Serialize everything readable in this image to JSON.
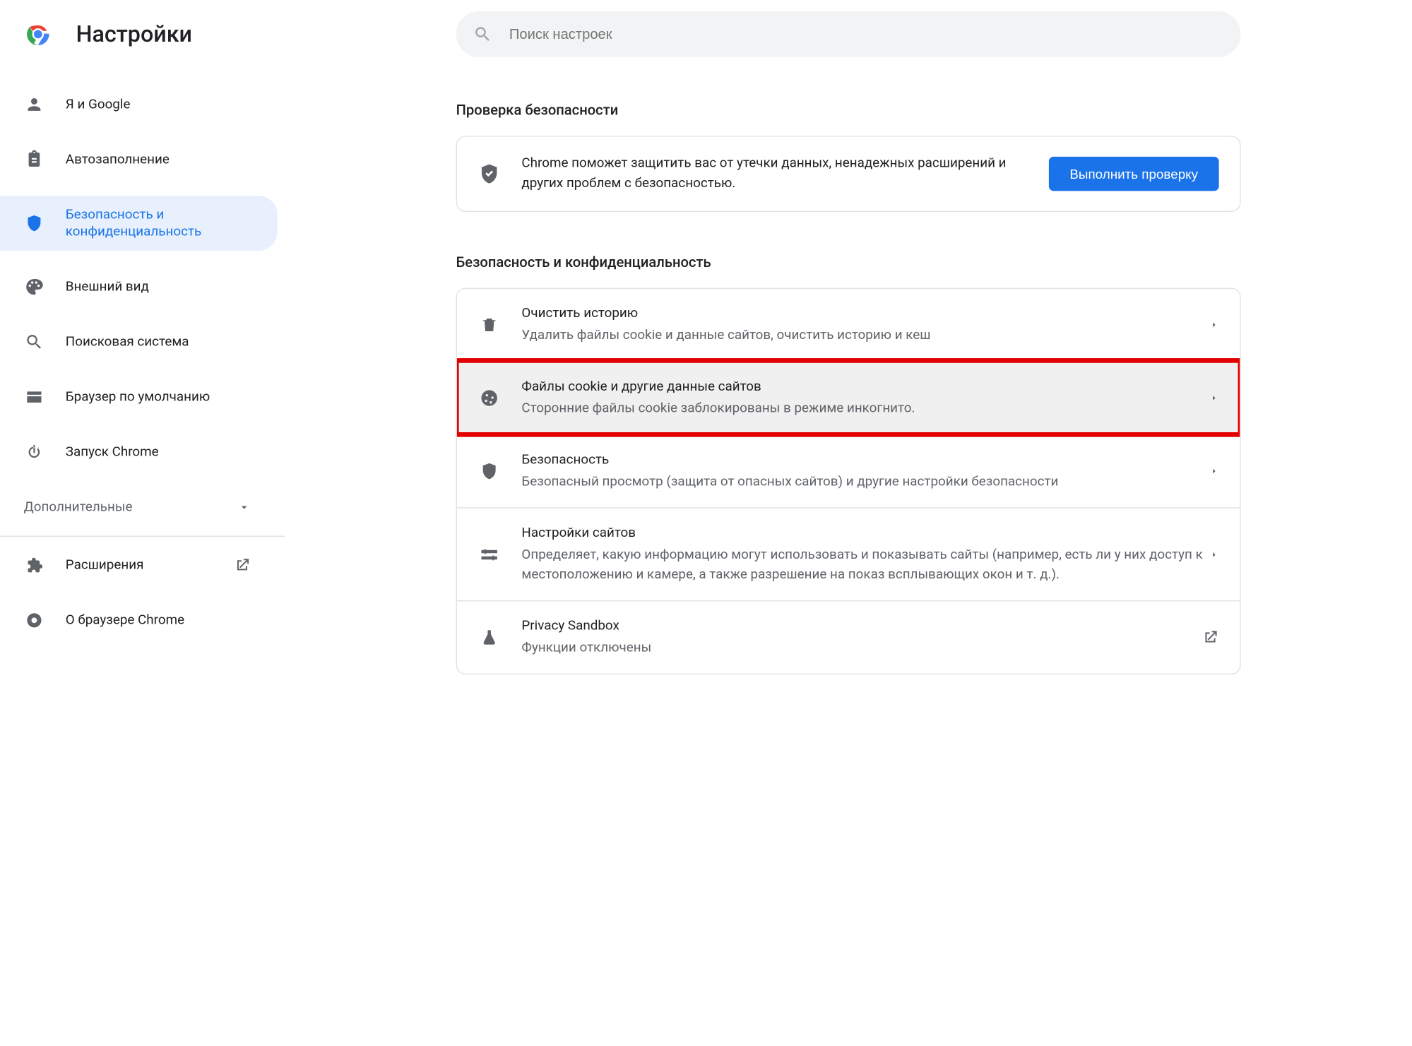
{
  "header": {
    "title": "Настройки",
    "search_placeholder": "Поиск настроек"
  },
  "sidebar": {
    "items": [
      {
        "label": "Я и Google"
      },
      {
        "label": "Автозаполнение"
      },
      {
        "label_line1": "Безопасность и",
        "label_line2": "конфиденциальность"
      },
      {
        "label": "Внешний вид"
      },
      {
        "label": "Поисковая система"
      },
      {
        "label": "Браузер по умолчанию"
      },
      {
        "label": "Запуск Chrome"
      }
    ],
    "advanced": "Дополнительные",
    "extensions": "Расширения",
    "about": "О браузере Chrome"
  },
  "safety": {
    "title": "Проверка безопасности",
    "message": "Chrome поможет защитить вас от утечки данных, ненадежных расширений и других проблем с безопасностью.",
    "button": "Выполнить проверку"
  },
  "privacy": {
    "title": "Безопасность и конфиденциальность",
    "items": [
      {
        "title": "Очистить историю",
        "sub": "Удалить файлы cookie и данные сайтов, очистить историю и кеш"
      },
      {
        "title": "Файлы cookie и другие данные сайтов",
        "sub": "Сторонние файлы cookie заблокированы в режиме инкогнито."
      },
      {
        "title": "Безопасность",
        "sub": "Безопасный просмотр (защита от опасных сайтов) и другие настройки безопасности"
      },
      {
        "title": "Настройки сайтов",
        "sub": "Определяет, какую информацию могут использовать и показывать сайты (например, есть ли у них доступ к местоположению и камере, а также разрешение на показ всплывающих окон и т. д.)."
      },
      {
        "title": "Privacy Sandbox",
        "sub": "Функции отключены"
      }
    ]
  }
}
